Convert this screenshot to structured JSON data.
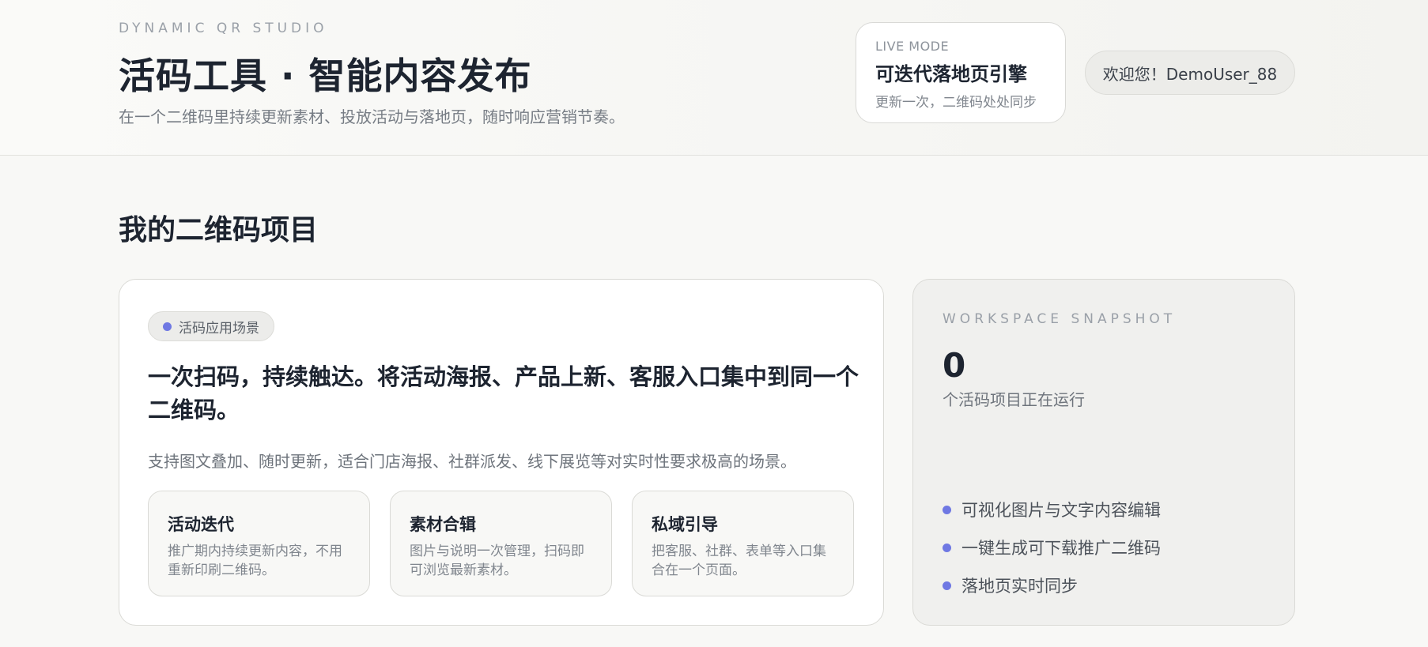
{
  "header": {
    "eyebrow": "DYNAMIC QR STUDIO",
    "title": "活码工具 · 智能内容发布",
    "subtitle": "在一个二维码里持续更新素材、投放活动与落地页，随时响应营销节奏。",
    "live_card": {
      "eyebrow": "LIVE MODE",
      "title": "可迭代落地页引擎",
      "subtitle": "更新一次，二维码处处同步"
    },
    "welcome": "欢迎您！DemoUser_88"
  },
  "main": {
    "section_title": "我的二维码项目",
    "card": {
      "tag": "活码应用场景",
      "headline": "一次扫码，持续触达。将活动海报、产品上新、客服入口集中到同一个二维码。",
      "description": "支持图文叠加、随时更新，适合门店海报、社群派发、线下展览等对实时性要求极高的场景。",
      "features": [
        {
          "title": "活动迭代",
          "desc": "推广期内持续更新内容，不用重新印刷二维码。"
        },
        {
          "title": "素材合辑",
          "desc": "图片与说明一次管理，扫码即可浏览最新素材。"
        },
        {
          "title": "私域引导",
          "desc": "把客服、社群、表单等入口集合在一个页面。"
        }
      ]
    },
    "snapshot": {
      "eyebrow": "WORKSPACE SNAPSHOT",
      "count": "0",
      "count_label": "个活码项目正在运行",
      "bullets": [
        "可视化图片与文字内容编辑",
        "一键生成可下载推广二维码",
        "落地页实时同步"
      ]
    }
  },
  "colors": {
    "accent": "#6f78e3",
    "text_dark": "#1d2430",
    "muted": "#80868e"
  }
}
